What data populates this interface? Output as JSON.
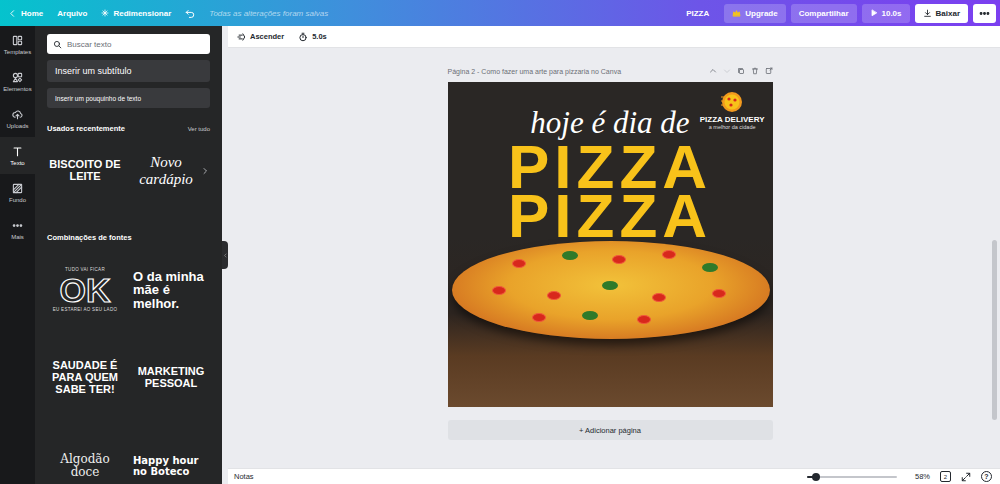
{
  "topbar": {
    "home": "Home",
    "file": "Arquivo",
    "resize": "Redimensionar",
    "save_status": "Todas as alterações foram salvas",
    "design_name": "PIZZA",
    "upgrade": "Upgrade",
    "share": "Compartilhar",
    "duration": "10.0s",
    "download": "Baixar"
  },
  "rail": [
    {
      "label": "Templates",
      "selected": false
    },
    {
      "label": "Elementos",
      "selected": false
    },
    {
      "label": "Uploads",
      "selected": false
    },
    {
      "label": "Texto",
      "selected": true
    },
    {
      "label": "Fundo",
      "selected": false
    },
    {
      "label": "Mais",
      "selected": false
    }
  ],
  "panel": {
    "search": {
      "placeholder": "Buscar texto"
    },
    "add_subtitle": "Inserir um subtítulo",
    "add_body": "Inserir um pouquinho de texto",
    "recent": {
      "title": "Usados recentemente",
      "see_all": "Ver tudo",
      "items": [
        {
          "lines": [
            {
              "text": "BISCOITO DE LEITE",
              "kind": "heavy"
            }
          ]
        },
        {
          "lines": [
            {
              "text": "Novo cardápio",
              "kind": "script"
            }
          ]
        }
      ]
    },
    "combos": {
      "title": "Combinações de fontes",
      "items": [
        {
          "lines": [
            {
              "text": "TUDO VAI FICAR",
              "kind": "small"
            },
            {
              "text": "OK",
              "kind": "outline"
            },
            {
              "text": "EU ESTAREI AO SEU LADO",
              "kind": "small"
            }
          ]
        },
        {
          "lines": [
            {
              "text": "O da minha mãe é melhor.",
              "kind": "heavy"
            }
          ]
        },
        {
          "lines": [
            {
              "text": "SAUDADE É PARA QUEM SABE TER!",
              "kind": "block"
            }
          ]
        },
        {
          "lines": [
            {
              "text": "MARKETING PESSOAL",
              "kind": "block"
            }
          ]
        },
        {
          "lines": [
            {
              "text": "Algodão doce",
              "kind": "light"
            }
          ]
        },
        {
          "lines": [
            {
              "text": "Happy hour no Boteco",
              "kind": "rounded"
            }
          ]
        }
      ]
    }
  },
  "toolbar": {
    "animation": "Ascender",
    "duration": "5.0s"
  },
  "page": {
    "title": "Página 2 - Como fazer uma arte para pizzaria no Canva",
    "design": {
      "script": "hoje é dia de",
      "headline": [
        "PIZZA",
        "PIZZA"
      ],
      "logo_name": "PIZZA DELIVERY",
      "logo_tagline": "a melhor da cidade"
    }
  },
  "add_page": "+ Adicionar página",
  "bottombar": {
    "notes": "Notas",
    "zoom_level": 0.1,
    "zoom": "58%",
    "page_count": "2",
    "help": "?"
  }
}
